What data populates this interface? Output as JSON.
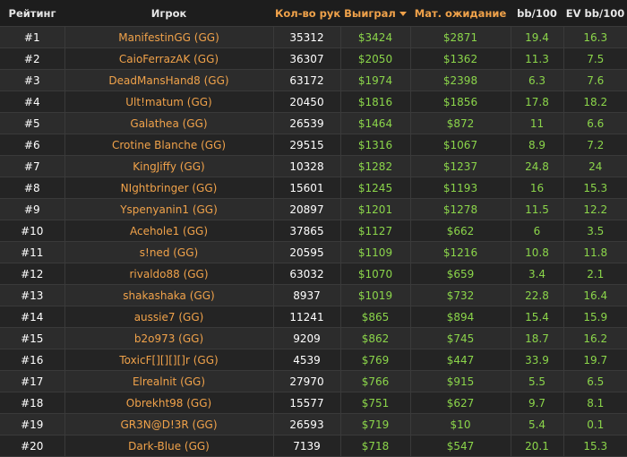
{
  "headers": {
    "rank": "Рейтинг",
    "player": "Игрок",
    "hands": "Кол-во рук",
    "won": "Выиграл",
    "ev": "Мат. ожидание",
    "bb100": "bb/100",
    "evbb100": "EV bb/100"
  },
  "colors": {
    "background": "#232323",
    "header_bg": "#1d1d1d",
    "accent_orange": "#f0a24a",
    "money_green": "#8bd54a",
    "text_white": "#ffffff"
  },
  "sort_icon": "caret-down-icon",
  "rows": [
    {
      "rank": "#1",
      "player": "ManifestinGG (GG)",
      "hands": "35312",
      "won": "$3424",
      "ev": "$2871",
      "bb100": "19.4",
      "evbb100": "16.3"
    },
    {
      "rank": "#2",
      "player": "CaioFerrazAK (GG)",
      "hands": "36307",
      "won": "$2050",
      "ev": "$1362",
      "bb100": "11.3",
      "evbb100": "7.5"
    },
    {
      "rank": "#3",
      "player": "DeadMansHand8 (GG)",
      "hands": "63172",
      "won": "$1974",
      "ev": "$2398",
      "bb100": "6.3",
      "evbb100": "7.6"
    },
    {
      "rank": "#4",
      "player": "Ult!matum (GG)",
      "hands": "20450",
      "won": "$1816",
      "ev": "$1856",
      "bb100": "17.8",
      "evbb100": "18.2"
    },
    {
      "rank": "#5",
      "player": "Galathea (GG)",
      "hands": "26539",
      "won": "$1464",
      "ev": "$872",
      "bb100": "11",
      "evbb100": "6.6"
    },
    {
      "rank": "#6",
      "player": "Crotine Blanche (GG)",
      "hands": "29515",
      "won": "$1316",
      "ev": "$1067",
      "bb100": "8.9",
      "evbb100": "7.2"
    },
    {
      "rank": "#7",
      "player": "KingJiffy (GG)",
      "hands": "10328",
      "won": "$1282",
      "ev": "$1237",
      "bb100": "24.8",
      "evbb100": "24"
    },
    {
      "rank": "#8",
      "player": "NIghtbringer (GG)",
      "hands": "15601",
      "won": "$1245",
      "ev": "$1193",
      "bb100": "16",
      "evbb100": "15.3"
    },
    {
      "rank": "#9",
      "player": "Yspenyanin1 (GG)",
      "hands": "20897",
      "won": "$1201",
      "ev": "$1278",
      "bb100": "11.5",
      "evbb100": "12.2"
    },
    {
      "rank": "#10",
      "player": "Acehole1 (GG)",
      "hands": "37865",
      "won": "$1127",
      "ev": "$662",
      "bb100": "6",
      "evbb100": "3.5"
    },
    {
      "rank": "#11",
      "player": "s!ned (GG)",
      "hands": "20595",
      "won": "$1109",
      "ev": "$1216",
      "bb100": "10.8",
      "evbb100": "11.8"
    },
    {
      "rank": "#12",
      "player": "rivaldo88 (GG)",
      "hands": "63032",
      "won": "$1070",
      "ev": "$659",
      "bb100": "3.4",
      "evbb100": "2.1"
    },
    {
      "rank": "#13",
      "player": "shakashaka (GG)",
      "hands": "8937",
      "won": "$1019",
      "ev": "$732",
      "bb100": "22.8",
      "evbb100": "16.4"
    },
    {
      "rank": "#14",
      "player": "aussie7 (GG)",
      "hands": "11241",
      "won": "$865",
      "ev": "$894",
      "bb100": "15.4",
      "evbb100": "15.9"
    },
    {
      "rank": "#15",
      "player": "b2o973 (GG)",
      "hands": "9209",
      "won": "$862",
      "ev": "$745",
      "bb100": "18.7",
      "evbb100": "16.2"
    },
    {
      "rank": "#16",
      "player": "ToxicF[][][][]r (GG)",
      "hands": "4539",
      "won": "$769",
      "ev": "$447",
      "bb100": "33.9",
      "evbb100": "19.7"
    },
    {
      "rank": "#17",
      "player": "Elrealnit (GG)",
      "hands": "27970",
      "won": "$766",
      "ev": "$915",
      "bb100": "5.5",
      "evbb100": "6.5"
    },
    {
      "rank": "#18",
      "player": "Obrekht98 (GG)",
      "hands": "15577",
      "won": "$751",
      "ev": "$627",
      "bb100": "9.7",
      "evbb100": "8.1"
    },
    {
      "rank": "#19",
      "player": "GR3N@D!3R (GG)",
      "hands": "26593",
      "won": "$719",
      "ev": "$10",
      "bb100": "5.4",
      "evbb100": "0.1"
    },
    {
      "rank": "#20",
      "player": "Dark-Blue (GG)",
      "hands": "7139",
      "won": "$718",
      "ev": "$547",
      "bb100": "20.1",
      "evbb100": "15.3"
    }
  ]
}
